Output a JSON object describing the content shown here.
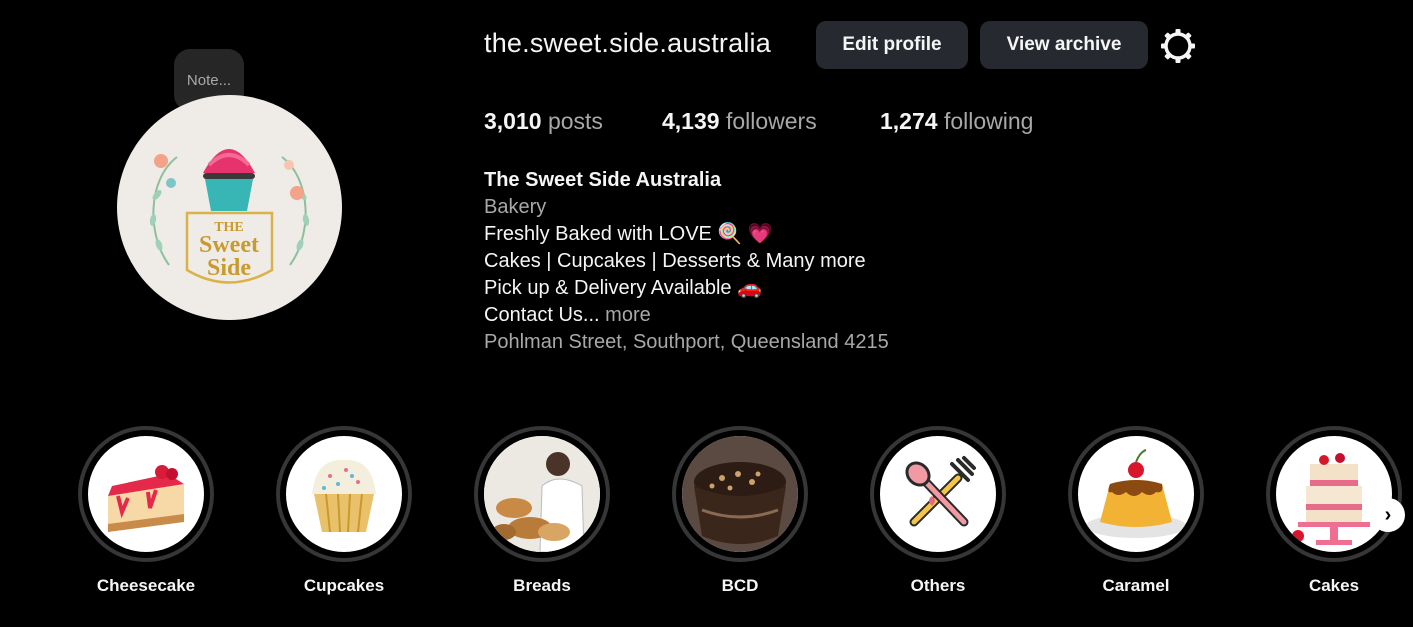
{
  "profile": {
    "username": "the.sweet.side.australia",
    "note_placeholder": "Note...",
    "logo_line1": "THE",
    "logo_line2": "Sweet",
    "logo_line3": "Side",
    "edit_profile_label": "Edit profile",
    "view_archive_label": "View archive",
    "settings_icon": "gear-icon"
  },
  "stats": {
    "posts_count": "3,010",
    "posts_label": "posts",
    "followers_count": "4,139",
    "followers_label": "followers",
    "following_count": "1,274",
    "following_label": "following"
  },
  "bio": {
    "name": "The Sweet Side Australia",
    "category": "Bakery",
    "line1": "Freshly Baked with LOVE 🍭 💗",
    "line2": "Cakes | Cupcakes | Desserts & Many more",
    "line3": "Pick up & Delivery Available 🚗",
    "line4": "Contact Us...",
    "more_label": "more",
    "address": "Pohlman Street, Southport, Queensland 4215"
  },
  "highlights": [
    {
      "label": "Cheesecake",
      "icon": "cheesecake-icon"
    },
    {
      "label": "Cupcakes",
      "icon": "cupcake-icon"
    },
    {
      "label": "Breads",
      "icon": "bread-icon"
    },
    {
      "label": "BCD",
      "icon": "dessert-cup-icon"
    },
    {
      "label": "Others",
      "icon": "spoon-fork-icon"
    },
    {
      "label": "Caramel",
      "icon": "flan-icon"
    },
    {
      "label": "Cakes",
      "icon": "layer-cake-icon"
    }
  ],
  "highlights_next": "›",
  "colors": {
    "background": "#000000",
    "button_bg": "#262a30",
    "muted_text": "#a8a8a8",
    "ring": "#363636"
  }
}
